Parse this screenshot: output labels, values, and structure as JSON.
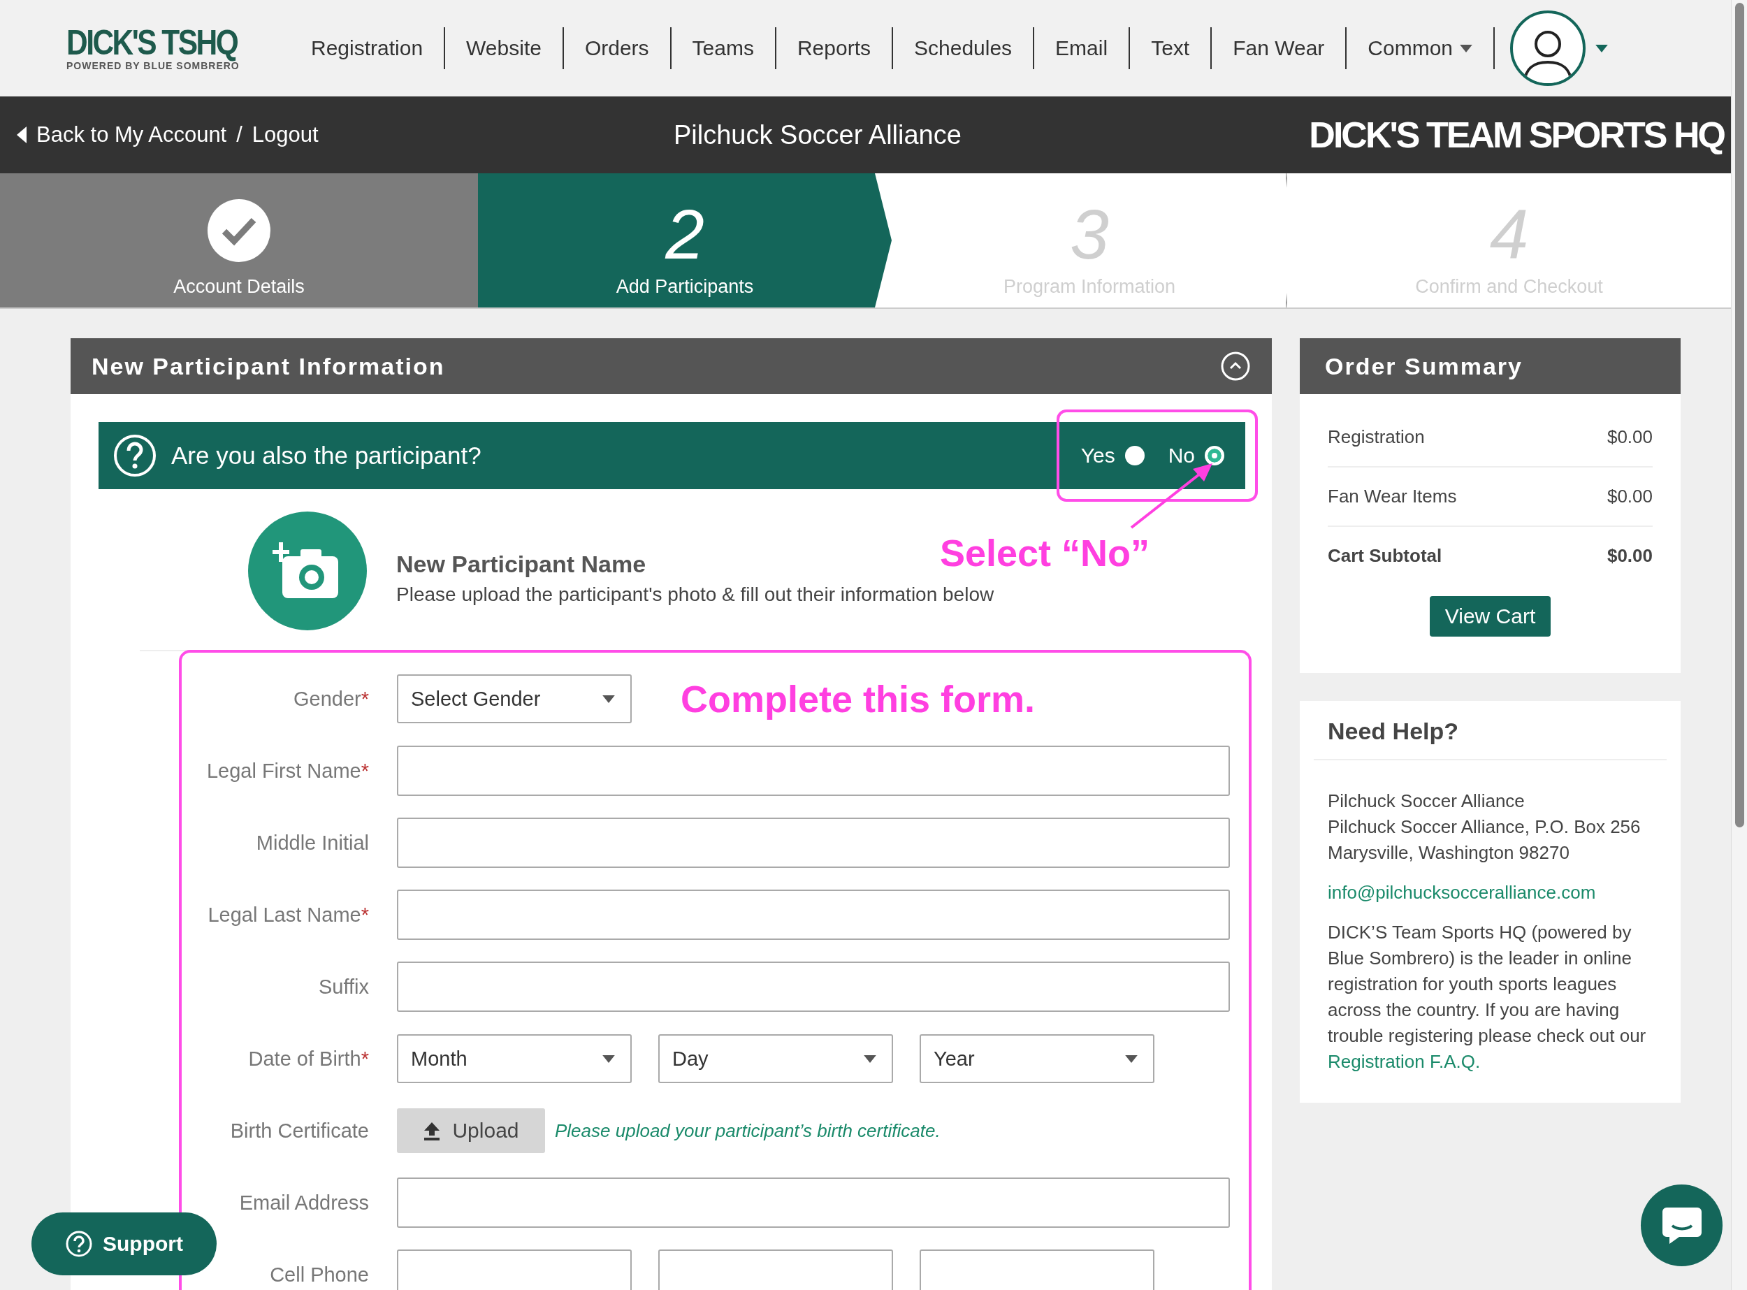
{
  "nav": {
    "logo": {
      "title": "DICK'S TSHQ",
      "tagline": "POWERED BY BLUE SOMBRERO"
    },
    "items": [
      {
        "label": "Registration",
        "dropdown": false
      },
      {
        "label": "Website",
        "dropdown": false
      },
      {
        "label": "Orders",
        "dropdown": false
      },
      {
        "label": "Teams",
        "dropdown": false
      },
      {
        "label": "Reports",
        "dropdown": false
      },
      {
        "label": "Schedules",
        "dropdown": false
      },
      {
        "label": "Email",
        "dropdown": false
      },
      {
        "label": "Text",
        "dropdown": false
      },
      {
        "label": "Fan Wear",
        "dropdown": false
      },
      {
        "label": "Common",
        "dropdown": true
      }
    ]
  },
  "account_bar": {
    "links": [
      "Back to My Account",
      "Logout"
    ],
    "separator": "/",
    "title": "Pilchuck Soccer Alliance",
    "brand": "DICK'S TEAM SPORTS HQ"
  },
  "steps": [
    {
      "completed": true,
      "selected": false,
      "label": "Account Details"
    },
    {
      "completed": false,
      "selected": true,
      "number": "2",
      "label": "Add Participants"
    },
    {
      "completed": false,
      "selected": false,
      "number": "3",
      "label": "Program Information"
    },
    {
      "completed": false,
      "selected": false,
      "number": "4",
      "label": "Confirm and Checkout"
    }
  ],
  "participant_panel": {
    "title": "New Participant Information",
    "question": {
      "text": "Are you also the participant?",
      "annotation": "Select “No”",
      "options": [
        {
          "label": "Yes",
          "selected": false
        },
        {
          "label": "No",
          "selected": true
        }
      ]
    },
    "participant": {
      "name": "New Participant Name",
      "hint": "Please upload the participant's photo & fill out their information below"
    },
    "form": {
      "annotation": "Complete this form.",
      "rows": [
        {
          "kind": "select",
          "label": "Gender",
          "required_mark": "*",
          "values": [
            "Select Gender"
          ]
        },
        {
          "kind": "text",
          "label": "Legal First Name",
          "required_mark": "*"
        },
        {
          "kind": "text",
          "label": "Middle Initial"
        },
        {
          "kind": "text",
          "label": "Legal Last Name",
          "required_mark": "*"
        },
        {
          "kind": "text",
          "label": "Suffix"
        },
        {
          "kind": "select",
          "label": "Date of Birth",
          "required_mark": "*",
          "values": [
            "Month",
            "Day",
            "Year"
          ]
        },
        {
          "kind": "upload",
          "label": "Birth Certificate",
          "button": "Upload",
          "note": "Please upload your participant’s birth certificate."
        },
        {
          "kind": "text",
          "label": "Email Address"
        },
        {
          "kind": "phone",
          "label": "Cell Phone"
        }
      ]
    }
  },
  "order_summary": {
    "title": "Order Summary",
    "rows": [
      {
        "label": "Registration",
        "amount": "$0.00",
        "total": false
      },
      {
        "label": "Fan Wear Items",
        "amount": "$0.00",
        "total": false
      },
      {
        "label": "Cart Subtotal",
        "amount": "$0.00",
        "total": true
      }
    ],
    "button": "View Cart"
  },
  "help": {
    "title": "Need Help?",
    "address": [
      "Pilchuck Soccer Alliance",
      "Pilchuck Soccer Alliance, P.O. Box 256",
      "Marysville, Washington 98270"
    ],
    "email": "info@pilchucksocceralliance.com",
    "about": "DICK’S Team Sports HQ (powered by Blue Sombrero) is the leader in online registration for youth sports leagues across the country. If you are having trouble registering please check out our",
    "faq_link": "Registration F.A.Q."
  },
  "support": {
    "label": "Support"
  }
}
